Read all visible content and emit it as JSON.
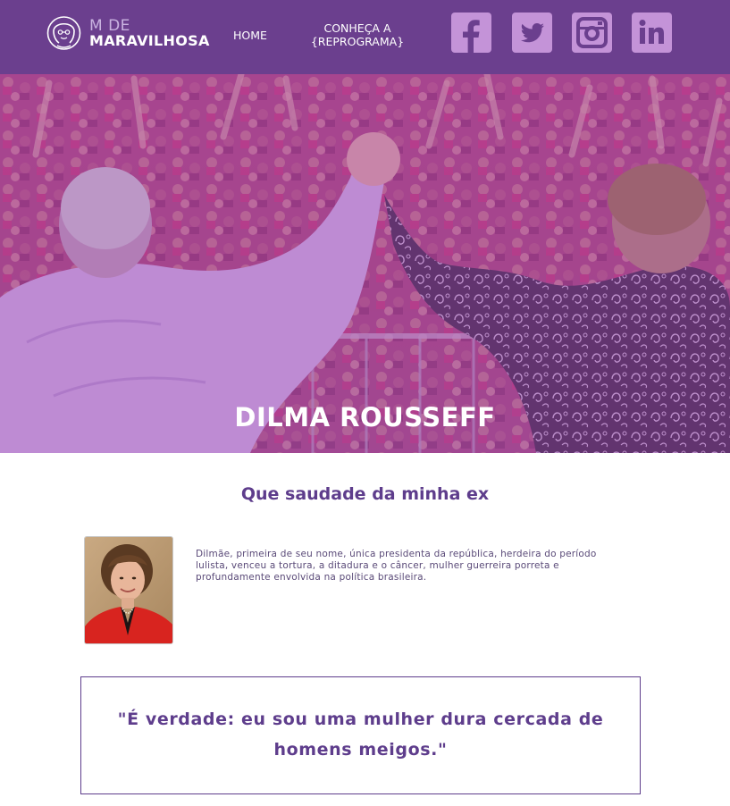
{
  "header": {
    "logo": {
      "line1": "M DE",
      "line2": "MARAVILHOSA"
    },
    "nav": [
      {
        "label": "HOME"
      },
      {
        "label_line1": "CONHEÇA A",
        "label_line2": "{REPROGRAMA}"
      }
    ],
    "social": [
      {
        "icon": "facebook-icon"
      },
      {
        "icon": "twitter-icon"
      },
      {
        "icon": "instagram-icon"
      },
      {
        "icon": "linkedin-icon"
      }
    ]
  },
  "hero": {
    "title": "DILMA ROUSSEFF"
  },
  "main": {
    "subtitle": "Que saudade da minha ex",
    "bio": "Dilmãe, primeira de seu nome, única presidenta da república, herdeira do período lulista, venceu a tortura, a ditadura e o câncer, mulher guerreira porreta e profundamente envolvida na política brasileira.",
    "quote_line1": "\"É verdade: eu sou uma mulher dura cercada de",
    "quote_line2": "homens meigos.\""
  },
  "colors": {
    "header_bg": "#6b3f8e",
    "accent_purple": "#5e3d8c",
    "social_bg": "#c493d8",
    "hero_overlay": "#a04fb5"
  }
}
